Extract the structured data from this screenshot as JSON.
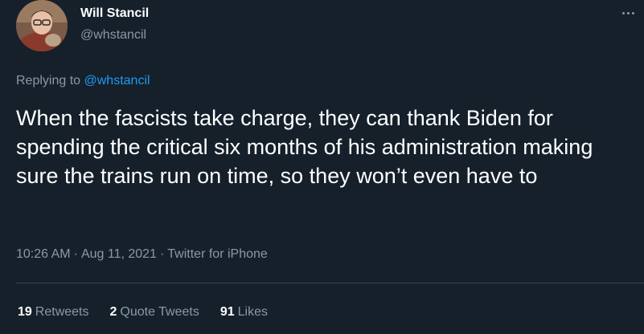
{
  "author": {
    "name": "Will Stancil",
    "handle": "@whstancil"
  },
  "reply": {
    "prefix": "Replying to",
    "handle": "@whstancil"
  },
  "tweet": {
    "text": "When the fascists take charge, they can thank Biden for spending the critical six months of his administration making sure the trains run on time, so they won’t even have to",
    "time": "10:26 AM",
    "date": "Aug 11, 2021",
    "source": "Twitter for iPhone",
    "separator": "·"
  },
  "stats": {
    "retweets_count": "19",
    "retweets_label": "Retweets",
    "quotes_count": "2",
    "quotes_label": "Quote Tweets",
    "likes_count": "91",
    "likes_label": "Likes"
  },
  "icons": {
    "more": "more-options-icon"
  },
  "colors": {
    "background": "#15202b",
    "primary_text": "#ffffff",
    "secondary_text": "#8b98a5",
    "link": "#1d9bf0",
    "divider": "#38444d"
  }
}
